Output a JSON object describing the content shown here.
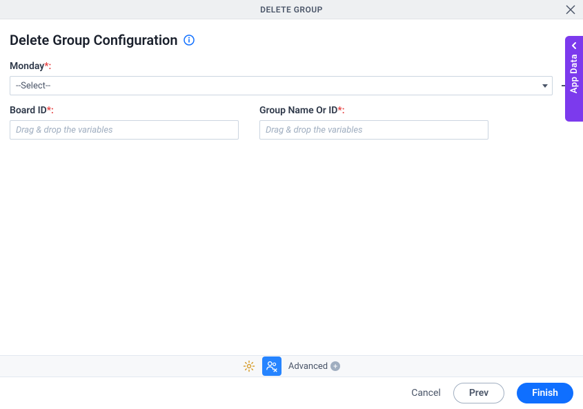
{
  "header": {
    "title": "DELETE GROUP"
  },
  "page": {
    "title": "Delete Group Configuration"
  },
  "form": {
    "monday": {
      "label": "Monday",
      "required_suffix": "*:",
      "selected": "--Select--"
    },
    "board_id": {
      "label": "Board ID",
      "required_suffix": "*:",
      "placeholder": "Drag & drop the variables",
      "value": ""
    },
    "group_name": {
      "label": "Group Name Or ID",
      "required_suffix": "*:",
      "placeholder": "Drag & drop the variables",
      "value": ""
    }
  },
  "bottom_bar": {
    "advanced_label": "Advanced"
  },
  "footer": {
    "cancel": "Cancel",
    "prev": "Prev",
    "finish": "Finish"
  },
  "side_tab": {
    "label": "App Data"
  }
}
